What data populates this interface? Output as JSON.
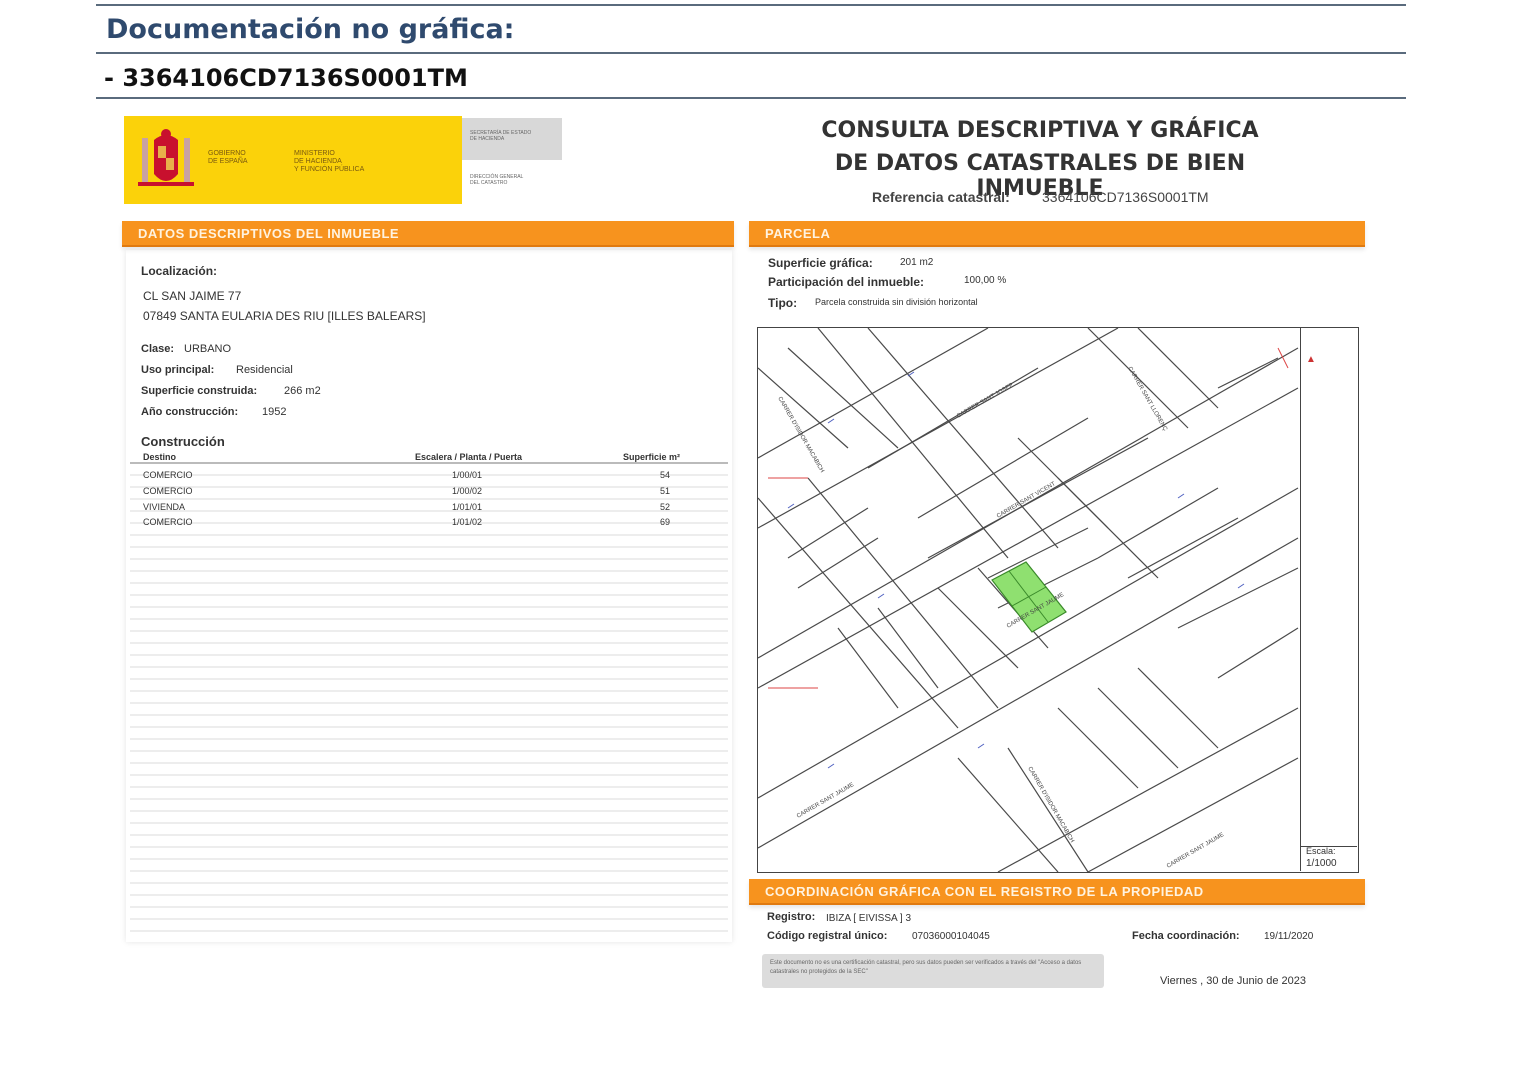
{
  "header": {
    "title": "Documentación no gráfica:",
    "reference_line": "- 3364106CD7136S0001TM"
  },
  "logo": {
    "gov_line1": "GOBIERNO",
    "gov_line2": "DE ESPAÑA",
    "ministry_line1": "MINISTERIO",
    "ministry_line2": "DE HACIENDA",
    "ministry_line3": "Y FUNCIÓN PÚBLICA",
    "sec_line1": "SECRETARÍA DE ESTADO",
    "sec_line2": "DE HACIENDA",
    "dir_line1": "DIRECCIÓN GENERAL",
    "dir_line2": "DEL CATASTRO",
    "colors": {
      "yellow": "#fbd20a",
      "red": "#c8102e"
    }
  },
  "doc": {
    "title_line1": "CONSULTA DESCRIPTIVA Y GRÁFICA",
    "title_line2": "DE DATOS CATASTRALES DE BIEN INMUEBLE",
    "ref_label": "Referencia catastral:",
    "ref_value": "3364106CD7136S0001TM",
    "accent_color": "#f7931e"
  },
  "descriptivos": {
    "section_title": "DATOS DESCRIPTIVOS DEL INMUEBLE",
    "localizacion_label": "Localización:",
    "address_line1": "CL SAN JAIME 77",
    "address_line2": "07849 SANTA EULARIA DES RIU [ILLES BALEARS]",
    "clase_label": "Clase:",
    "clase_value": "URBANO",
    "uso_label": "Uso principal:",
    "uso_value": "Residencial",
    "superficie_label": "Superficie construida:",
    "superficie_value": "266 m2",
    "anio_label": "Año construcción:",
    "anio_value": "1952",
    "construccion_label": "Construcción",
    "table": {
      "headers": [
        "Destino",
        "Escalera / Planta / Puerta",
        "Superficie m²"
      ],
      "rows": [
        [
          "COMERCIO",
          "1/00/01",
          "54"
        ],
        [
          "COMERCIO",
          "1/00/02",
          "51"
        ],
        [
          "VIVIENDA",
          "1/01/01",
          "52"
        ],
        [
          "COMERCIO",
          "1/01/02",
          "69"
        ]
      ]
    }
  },
  "parcela": {
    "section_title": "PARCELA",
    "superficie_label": "Superficie gráfica:",
    "superficie_value": "201 m2",
    "participacion_label": "Participación del inmueble:",
    "participacion_value": "100,00 %",
    "tipo_label": "Tipo:",
    "tipo_value": "Parcela construida sin división horizontal",
    "map": {
      "scale_label": "Escala:",
      "scale_value": "1/1000",
      "streets": [
        "CARRER SANT JAUME",
        "CARRER SANT JAUME",
        "CARRER SANT JAUME",
        "CARRER SANT VICENT",
        "CARRER SANT JOSEP",
        "CARRER D'ISIDOR MACABICH",
        "CARRER D'ISIDOR MACABICH",
        "CARRER SANT LLORENÇ"
      ],
      "parcel_color": "#8fe070"
    }
  },
  "coordinacion": {
    "section_title": "COORDINACIÓN GRÁFICA CON EL REGISTRO DE LA PROPIEDAD",
    "registro_label": "Registro:",
    "registro_value": "IBIZA [ EIVISSA ] 3",
    "codigo_label": "Código registral único:",
    "codigo_value": "07036000104045",
    "fecha_label": "Fecha coordinación:",
    "fecha_value": "19/11/2020",
    "notice": "Este documento no es una certificación catastral, pero sus datos pueden ser verificados a través del \"Acceso a datos catastrales no protegidos de la SEC\"",
    "date": "Viernes , 30 de Junio de 2023"
  }
}
